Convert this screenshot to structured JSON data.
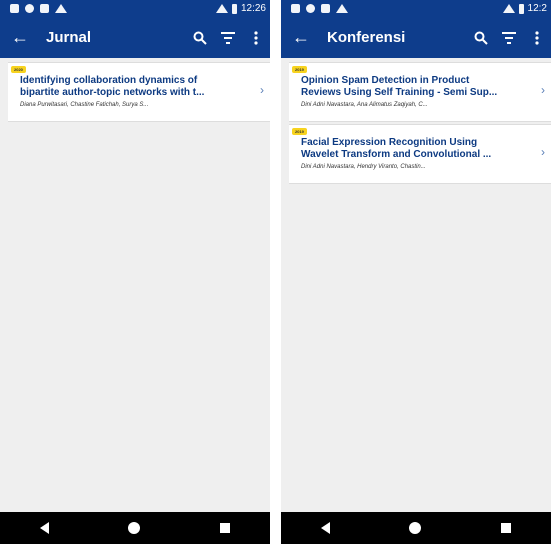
{
  "status": {
    "left_time": "12:26",
    "right_time": "12:2"
  },
  "left": {
    "title": "Jurnal",
    "cards": [
      {
        "year": "2020",
        "title_line1": "Identifying collaboration dynamics of",
        "title_line2": "bipartite author-topic networks with t...",
        "authors": "Diana Purwitasari, Chastine Fatichah, Surya S..."
      }
    ]
  },
  "right": {
    "title": "Konferensi",
    "cards": [
      {
        "year": "2019",
        "title_line1": "Opinion Spam Detection in Product",
        "title_line2": "Reviews Using Self Training - Semi Sup...",
        "authors": "Dini Adni Navastara, Ana Alimatus Zaqiyah, C..."
      },
      {
        "year": "2019",
        "title_line1": "Facial Expression Recognition Using",
        "title_line2": "Wavelet Transform and Convolutional ...",
        "authors": "Dini Adni Navastara, Hendry Viranto, Chastin..."
      }
    ]
  },
  "icons": {
    "back": "arrow-left-icon",
    "search": "search-icon",
    "filter": "filter-icon",
    "more": "more-vertical-icon",
    "chevron": "chevron-right-icon"
  },
  "colors": {
    "primary": "#0e3d8c",
    "badge": "#f7d31f",
    "title_text": "#0d3a82"
  }
}
